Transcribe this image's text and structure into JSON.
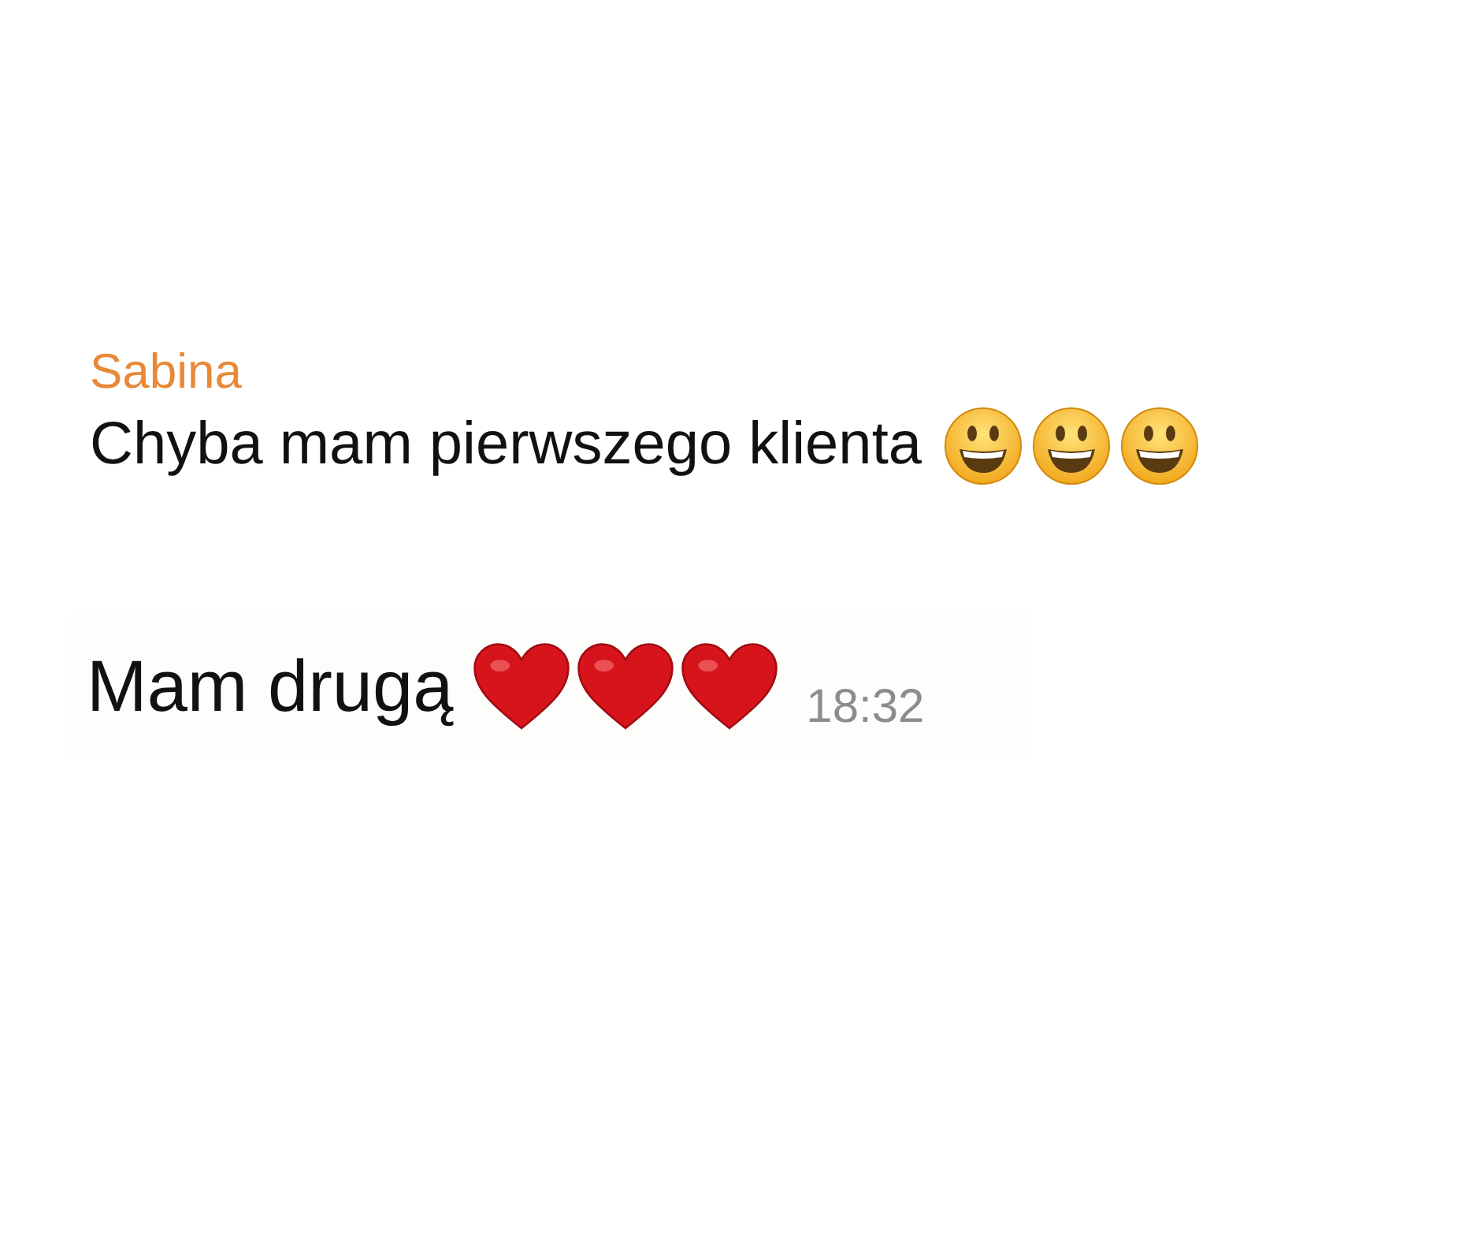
{
  "messages": [
    {
      "sender": "Sabina",
      "text": "Chyba mam pierwszego klienta",
      "emojis": [
        {
          "kind": "smiley"
        },
        {
          "kind": "smiley"
        },
        {
          "kind": "smiley"
        }
      ]
    },
    {
      "text": "Mam drugą",
      "emojis": [
        {
          "kind": "heart"
        },
        {
          "kind": "heart"
        },
        {
          "kind": "heart"
        }
      ],
      "time": "18:32"
    }
  ]
}
